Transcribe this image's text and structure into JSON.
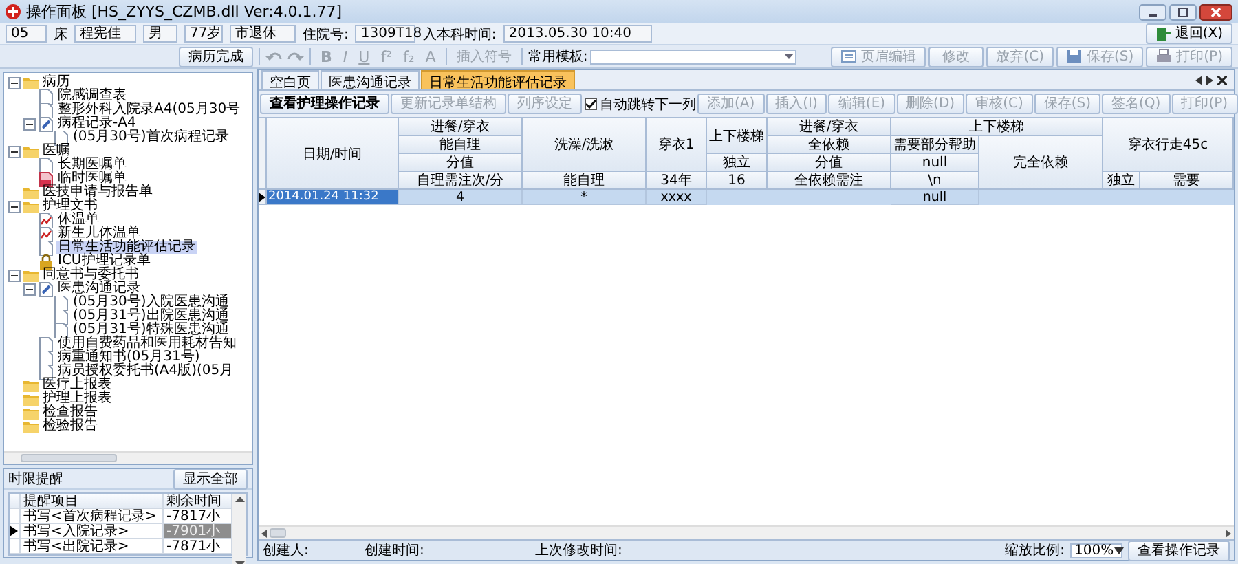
{
  "window": {
    "title": "操作面板 [HS_ZYYS_CZMB.dll Ver:4.0.1.77]"
  },
  "patient": {
    "bed": "05",
    "bed_label": "床",
    "name": "程宪佳",
    "sex": "男",
    "age": "77岁",
    "category": "市退休",
    "admission_no_label": "住院号:",
    "admission_no": "1309T18",
    "admit_time_label": "入本科时间:",
    "admit_time": "2013.05.30 10:40",
    "back_button": "退回(X)"
  },
  "toolbar": {
    "complete_button": "病历完成",
    "format_buttons": [
      {
        "label": "B",
        "disabled": true
      },
      {
        "label": "I",
        "disabled": true
      },
      {
        "label": "U",
        "disabled": true
      },
      {
        "label": "f²",
        "disabled": true
      },
      {
        "label": "f₂",
        "disabled": true
      },
      {
        "label": "A",
        "disabled": true
      }
    ],
    "insert_symbol": {
      "label": "插入符号",
      "disabled": true
    },
    "template_label": "常用模板:",
    "right_buttons": [
      {
        "label": "页眉编辑",
        "kind": "header",
        "disabled": true
      },
      {
        "label": "修改",
        "kind": "plain",
        "disabled": true
      },
      {
        "label": "放弃(C)",
        "kind": "plain",
        "disabled": true
      },
      {
        "label": "保存(S)",
        "kind": "save",
        "disabled": true
      },
      {
        "label": "打印(P)",
        "kind": "print",
        "disabled": true
      }
    ]
  },
  "tree": [
    {
      "label": "病历",
      "kind": "folder",
      "expanded": true,
      "selected": false,
      "children": [
        {
          "label": "院感调查表",
          "kind": "doc",
          "selected": false
        },
        {
          "label": "整形外科入院录A4(05月30号",
          "kind": "doc",
          "selected": false
        },
        {
          "label": "病程记录-A4",
          "kind": "doc-edit",
          "expanded": true,
          "selected": false,
          "children": [
            {
              "label": "(05月30号)首次病程记录",
              "kind": "doc",
              "selected": false
            }
          ]
        }
      ]
    },
    {
      "label": "医嘱",
      "kind": "folder",
      "expanded": true,
      "selected": false,
      "children": [
        {
          "label": "长期医嘱单",
          "kind": "doc",
          "selected": false
        },
        {
          "label": "临时医嘱单",
          "kind": "doc-red",
          "selected": false
        }
      ]
    },
    {
      "label": "医技申请与报告单",
      "kind": "folder",
      "selected": false
    },
    {
      "label": "护理文书",
      "kind": "folder",
      "expanded": true,
      "selected": false,
      "children": [
        {
          "label": "体温单",
          "kind": "doc-chart",
          "selected": false
        },
        {
          "label": "新生儿体温单",
          "kind": "doc-chart",
          "selected": false
        },
        {
          "label": "日常生活功能评估记录",
          "kind": "doc",
          "selected": true
        },
        {
          "label": "ICU护理记录单",
          "kind": "lock",
          "selected": false
        }
      ]
    },
    {
      "label": "同意书与委托书",
      "kind": "folder",
      "expanded": true,
      "selected": false,
      "children": [
        {
          "label": "医患沟通记录",
          "kind": "doc-edit",
          "expanded": true,
          "selected": false,
          "children": [
            {
              "label": "(05月30号)入院医患沟通",
              "kind": "doc",
              "selected": false
            },
            {
              "label": "(05月31号)出院医患沟通",
              "kind": "doc",
              "selected": false
            },
            {
              "label": "(05月31号)特殊医患沟通",
              "kind": "doc",
              "selected": false
            }
          ]
        },
        {
          "label": "使用自费药品和医用耗材告知",
          "kind": "doc",
          "selected": false
        },
        {
          "label": "病重通知书(05月31号)",
          "kind": "doc",
          "selected": false
        },
        {
          "label": "病员授权委托书(A4版)(05月",
          "kind": "doc",
          "selected": false
        }
      ]
    },
    {
      "label": "医疗上报表",
      "kind": "folder",
      "selected": false
    },
    {
      "label": "护理上报表",
      "kind": "folder",
      "selected": false
    },
    {
      "label": "检查报告",
      "kind": "folder",
      "selected": false
    },
    {
      "label": "检验报告",
      "kind": "folder",
      "selected": false
    }
  ],
  "reminder": {
    "title": "时限提醒",
    "show_all_button": "显示全部",
    "columns": [
      "提醒项目",
      "剩余时间"
    ],
    "rows": [
      {
        "item": "书写<首次病程记录>",
        "remaining": "-7817小",
        "selected": false
      },
      {
        "item": "书写<入院记录>",
        "remaining": "-7901小",
        "selected": true
      },
      {
        "item": "书写<出院记录>",
        "remaining": "-7871小",
        "selected": false
      }
    ]
  },
  "doc_tabs": [
    {
      "label": "空白页",
      "selected": false
    },
    {
      "label": "医患沟通记录",
      "selected": false
    },
    {
      "label": "日常生活功能评估记录",
      "selected": true
    }
  ],
  "record_toolbar": {
    "left_buttons": [
      {
        "label": "查看护理操作记录",
        "disabled": false
      },
      {
        "label": "更新记录单结构",
        "disabled": true
      },
      {
        "label": "列序设定",
        "disabled": true
      }
    ],
    "auto_next": {
      "label": "自动跳转下一列",
      "checked": true
    },
    "action_buttons": [
      {
        "label": "添加(A)",
        "disabled": true
      },
      {
        "label": "插入(I)",
        "disabled": true
      },
      {
        "label": "编辑(E)",
        "disabled": true
      },
      {
        "label": "删除(D)",
        "disabled": true
      },
      {
        "label": "审核(C)",
        "disabled": true
      },
      {
        "label": "保存(S)",
        "disabled": true
      },
      {
        "label": "签名(Q)",
        "disabled": true
      },
      {
        "label": "打印(P)",
        "disabled": true
      }
    ]
  },
  "grid": {
    "header_cells": [
      "日期/时间",
      "进餐/穿衣",
      "洗澡/洗漱",
      "穿衣1",
      "上下楼梯",
      "进餐/穿衣",
      "上下楼梯",
      "能自理",
      "全依赖",
      "需要部分帮助",
      "穿衣行走45c",
      "分值",
      "独立",
      "分值",
      "null",
      "完全依赖",
      "自理需注次/分",
      "能自理",
      "34年",
      "16",
      "全依赖需注",
      "\\n",
      "独立",
      "需要"
    ],
    "rows": [
      {
        "selected": true,
        "cells": [
          "2014.01.24 11:32",
          "4",
          "*",
          "xxxx",
          null,
          null,
          "null",
          null,
          null,
          null
        ]
      }
    ]
  },
  "status_bar": {
    "creator_label": "创建人:",
    "created_label": "创建时间:",
    "modified_label": "上次修改时间:",
    "zoom_label": "缩放比例:",
    "zoom_value": "100%",
    "log_button": "查看操作记录"
  }
}
